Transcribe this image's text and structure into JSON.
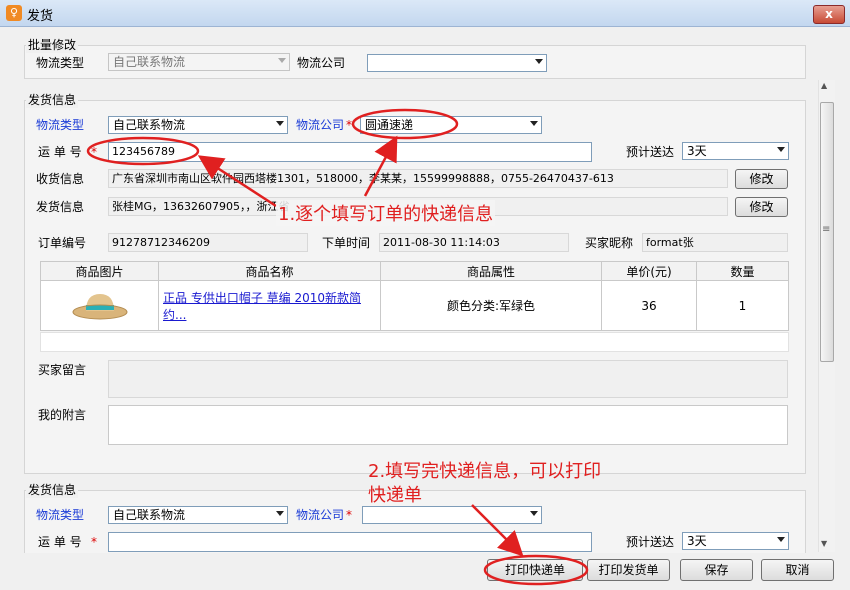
{
  "window": {
    "title": "发货",
    "close": "x"
  },
  "batch": {
    "legend": "批量修改",
    "logistics_type_label": "物流类型",
    "logistics_type_value": "自己联系物流",
    "company_label": "物流公司",
    "company_value": ""
  },
  "ship1": {
    "legend": "发货信息",
    "logistics_type_label": "物流类型",
    "logistics_type_value": "自己联系物流",
    "company_label": "物流公司",
    "company_value": "圆通速递",
    "waybill_label": "运 单 号",
    "waybill_value": "123456789",
    "eta_label": "预计送达",
    "eta_value": "3天",
    "receive_label": "收货信息",
    "receive_value": "广东省深圳市南山区软件园西塔楼1301，518000，李某某，15599998888，0755-26470437-613",
    "send_label": "发货信息",
    "send_value": "张桂MG，13632607905，，浙江省",
    "modify_label": "修改",
    "order_no_label": "订单编号",
    "order_no_value": "91278712346209",
    "order_time_label": "下单时间",
    "order_time_value": "2011-08-30 11:14:03",
    "buyer_nick_label": "买家昵称",
    "buyer_nick_value": "format张",
    "table_headers": [
      "商品图片",
      "商品名称",
      "商品属性",
      "单价(元)",
      "数量"
    ],
    "item": {
      "name": "正品 专供出口帽子 草编 2010新款简约...",
      "attr": "颜色分类:军绿色",
      "price": "36",
      "qty": "1",
      "image": "straw-hat"
    },
    "buyer_msg_label": "买家留言",
    "my_note_label": "我的附言"
  },
  "ship2": {
    "legend": "发货信息",
    "logistics_type_label": "物流类型",
    "logistics_type_value": "自己联系物流",
    "company_label": "物流公司",
    "company_value": "",
    "waybill_label": "运 单 号",
    "eta_label": "预计送达",
    "eta_value": "3天"
  },
  "annotations": {
    "note1": "1.逐个填写订单的快递信息",
    "note2_line1": "2.填写完快递信息，可以打印",
    "note2_line2": "快递单",
    "color": "#e02020"
  },
  "footer": {
    "print_express": "打印快递单",
    "print_ship": "打印发货单",
    "save": "保存",
    "cancel": "取消"
  },
  "required_mark": "*",
  "scrollbar": {
    "up": "▲",
    "down": "▼",
    "grip": "≡"
  }
}
